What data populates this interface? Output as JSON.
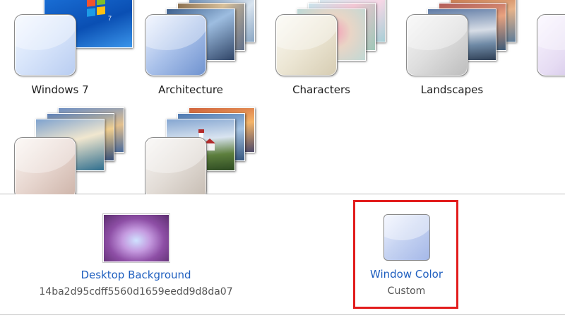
{
  "themes": [
    {
      "name": "Windows 7"
    },
    {
      "name": "Architecture"
    },
    {
      "name": "Characters"
    },
    {
      "name": "Landscapes"
    },
    {
      "name": ""
    },
    {
      "name": ""
    }
  ],
  "settings": {
    "desktop_background": {
      "title": "Desktop Background",
      "value": "14ba2d95cdff5560d1659eedd9d8da07"
    },
    "window_color": {
      "title": "Window Color",
      "value": "Custom"
    }
  },
  "colors": {
    "link": "#1f5fbf",
    "highlight_border": "#e21d1d",
    "glass_tint": "#c7d4f2"
  }
}
